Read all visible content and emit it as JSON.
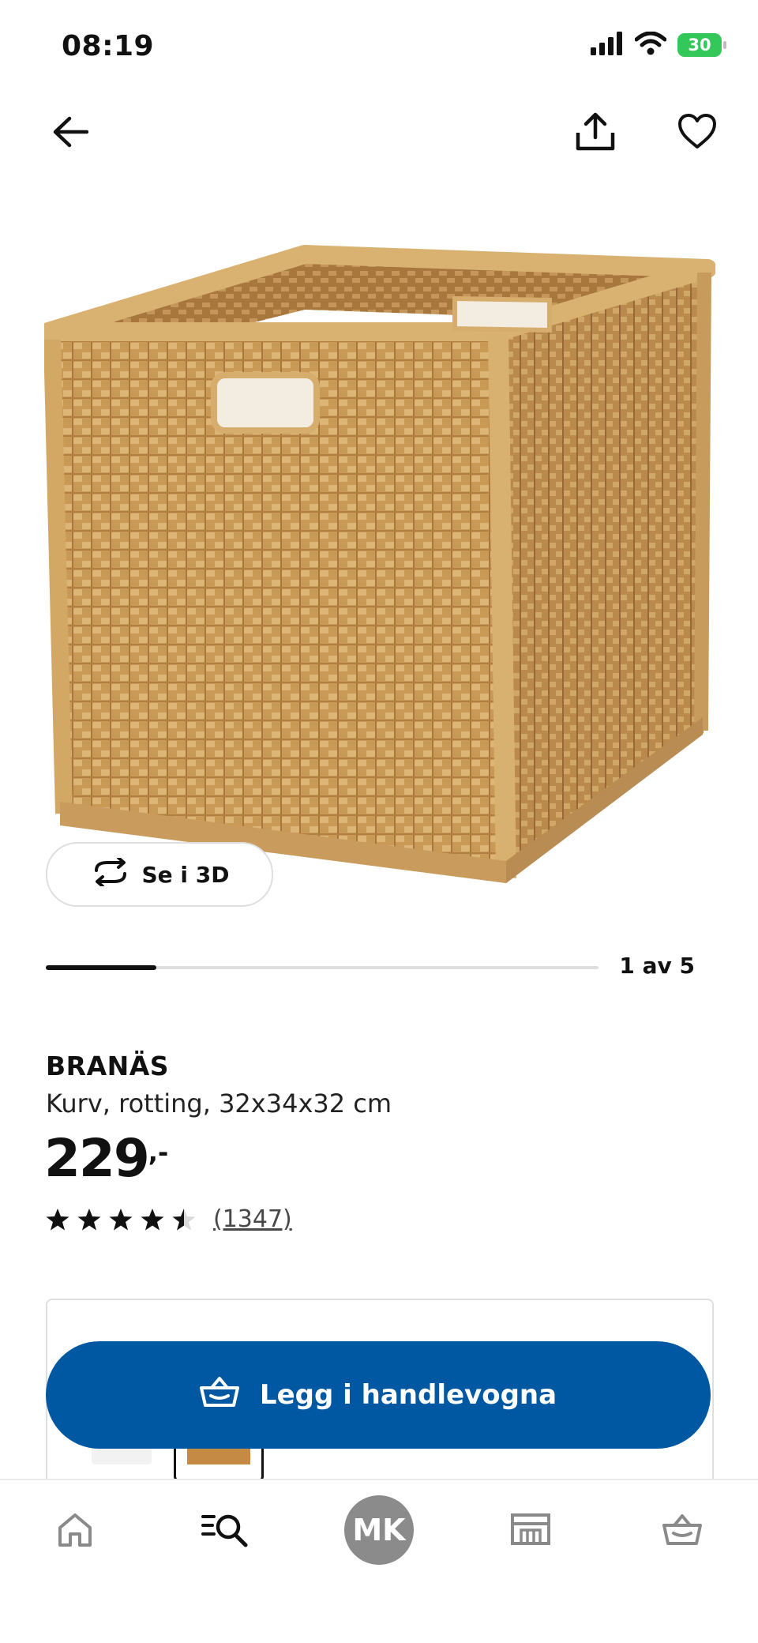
{
  "status_bar": {
    "time": "08:19",
    "battery": "30"
  },
  "product": {
    "brand": "BRANÄS",
    "description": "Kurv, rotting, 32x34x32 cm",
    "price": "229",
    "price_suffix": ",-",
    "rating_stars": 4.5,
    "rating_max": 5,
    "review_count": "(1347)"
  },
  "gallery": {
    "view_3d_label": "Se i 3D",
    "position_label": "1 av 5",
    "progress": 0.2
  },
  "cta": {
    "add_to_cart_label": "Legg i handlevogna"
  },
  "bottom_nav": {
    "avatar_initials": "MK"
  },
  "colors": {
    "primary_blue": "#0058a3",
    "battery_green": "#34c759",
    "rattan": "#c99a55"
  }
}
